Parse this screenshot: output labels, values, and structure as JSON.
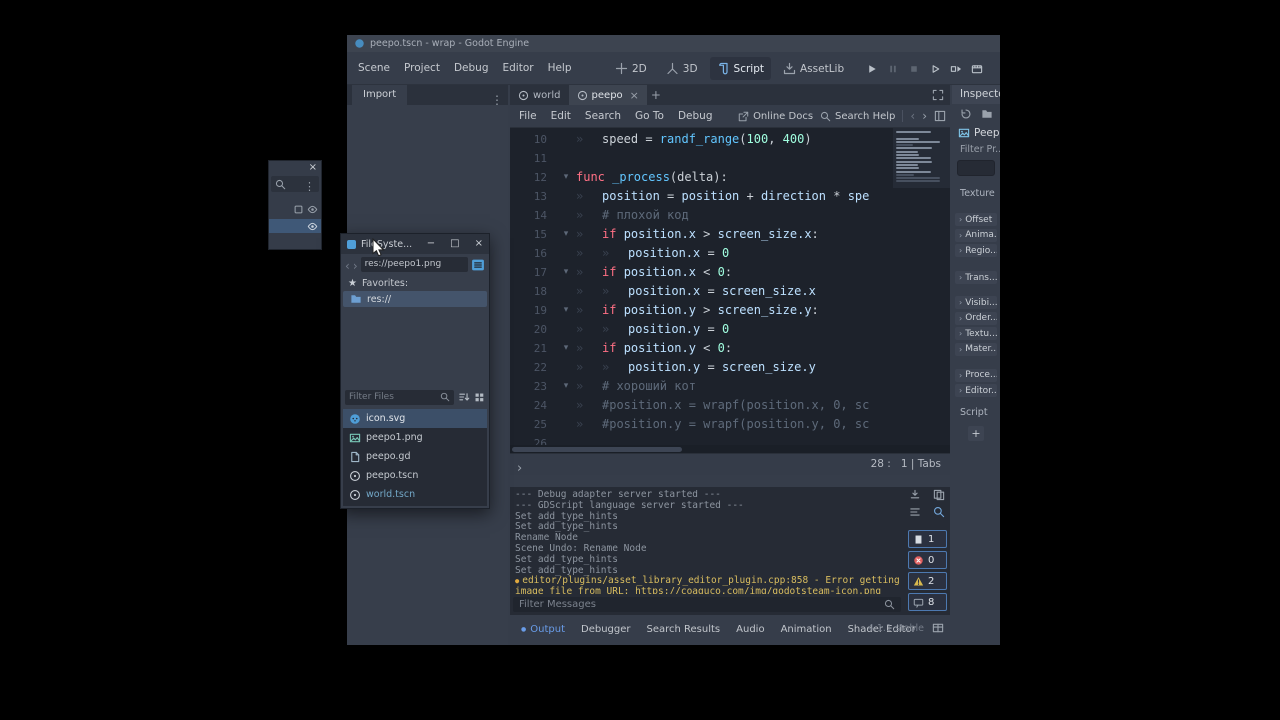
{
  "window": {
    "title": "peepo.tscn - wrap - Godot Engine"
  },
  "menubar": {
    "items": [
      "Scene",
      "Project",
      "Debug",
      "Editor",
      "Help"
    ]
  },
  "context_switcher": [
    {
      "label": "2D",
      "icon": "2d-icon",
      "active": false
    },
    {
      "label": "3D",
      "icon": "3d-icon",
      "active": false
    },
    {
      "label": "Script",
      "icon": "script-icon",
      "active": true
    },
    {
      "label": "AssetLib",
      "icon": "assetlib-icon",
      "active": false
    }
  ],
  "playbar": [
    {
      "icon": "play-icon",
      "enabled": true
    },
    {
      "icon": "pause-icon",
      "enabled": false
    },
    {
      "icon": "stop-icon",
      "enabled": false
    },
    {
      "icon": "play-scene-icon",
      "enabled": true
    },
    {
      "icon": "play-custom-scene-icon",
      "enabled": true
    },
    {
      "icon": "movie-maker-icon",
      "enabled": true
    }
  ],
  "left_dock": {
    "tab": "Import"
  },
  "scene_tabs": {
    "new_tab_label": "+",
    "tabs": [
      {
        "label": "world",
        "active": false,
        "closable": false
      },
      {
        "label": "peepo",
        "active": true,
        "closable": true
      }
    ]
  },
  "script_editor": {
    "menus": [
      "File",
      "Edit",
      "Search",
      "Go To",
      "Debug"
    ],
    "online_docs": "Online Docs",
    "search_help": "Search Help",
    "status": "28 :   1 | Tabs",
    "code": [
      {
        "n": "10",
        "fold": false,
        "ind": 1,
        "seg": [
          [
            "speed = ",
            "txt"
          ],
          [
            "randf_range",
            "fn"
          ],
          [
            "(",
            "txt"
          ],
          [
            "100",
            "num"
          ],
          [
            ", ",
            "txt"
          ],
          [
            "400",
            "num"
          ],
          [
            ")",
            "txt"
          ]
        ]
      },
      {
        "n": "11",
        "fold": false,
        "ind": 0,
        "seg": []
      },
      {
        "n": "12",
        "fold": true,
        "ind": 0,
        "seg": [
          [
            "func ",
            "kw"
          ],
          [
            "_process",
            "fn"
          ],
          [
            "(delta):",
            "txt"
          ]
        ]
      },
      {
        "n": "13",
        "fold": false,
        "ind": 1,
        "seg": [
          [
            "position",
            "mem"
          ],
          [
            " = ",
            "txt"
          ],
          [
            "position",
            "mem"
          ],
          [
            " + ",
            "txt"
          ],
          [
            "direction",
            "mem"
          ],
          [
            " * ",
            "txt"
          ],
          [
            "spe",
            "mem"
          ]
        ]
      },
      {
        "n": "14",
        "fold": false,
        "ind": 1,
        "seg": [
          [
            "# плохой код",
            "com"
          ]
        ]
      },
      {
        "n": "15",
        "fold": true,
        "ind": 1,
        "seg": [
          [
            "if ",
            "kw"
          ],
          [
            "position.x",
            "mem"
          ],
          [
            " > ",
            "txt"
          ],
          [
            "screen_size.x",
            "mem"
          ],
          [
            ":",
            "txt"
          ]
        ]
      },
      {
        "n": "16",
        "fold": false,
        "ind": 2,
        "seg": [
          [
            "position.x",
            "mem"
          ],
          [
            " = ",
            "txt"
          ],
          [
            "0",
            "num"
          ]
        ]
      },
      {
        "n": "17",
        "fold": true,
        "ind": 1,
        "seg": [
          [
            "if ",
            "kw"
          ],
          [
            "position.x",
            "mem"
          ],
          [
            " < ",
            "txt"
          ],
          [
            "0",
            "num"
          ],
          [
            ":",
            "txt"
          ]
        ]
      },
      {
        "n": "18",
        "fold": false,
        "ind": 2,
        "seg": [
          [
            "position.x",
            "mem"
          ],
          [
            " = ",
            "txt"
          ],
          [
            "screen_size.x",
            "mem"
          ]
        ]
      },
      {
        "n": "19",
        "fold": true,
        "ind": 1,
        "seg": [
          [
            "if ",
            "kw"
          ],
          [
            "position.y",
            "mem"
          ],
          [
            " > ",
            "txt"
          ],
          [
            "screen_size.y",
            "mem"
          ],
          [
            ":",
            "txt"
          ]
        ]
      },
      {
        "n": "20",
        "fold": false,
        "ind": 2,
        "seg": [
          [
            "position.y",
            "mem"
          ],
          [
            " = ",
            "txt"
          ],
          [
            "0",
            "num"
          ]
        ]
      },
      {
        "n": "21",
        "fold": true,
        "ind": 1,
        "seg": [
          [
            "if ",
            "kw"
          ],
          [
            "position.y",
            "mem"
          ],
          [
            " < ",
            "txt"
          ],
          [
            "0",
            "num"
          ],
          [
            ":",
            "txt"
          ]
        ]
      },
      {
        "n": "22",
        "fold": false,
        "ind": 2,
        "seg": [
          [
            "position.y",
            "mem"
          ],
          [
            " = ",
            "txt"
          ],
          [
            "screen_size.y",
            "mem"
          ]
        ]
      },
      {
        "n": "23",
        "fold": true,
        "ind": 1,
        "seg": [
          [
            "# хороший кот",
            "com"
          ]
        ]
      },
      {
        "n": "24",
        "fold": false,
        "ind": 1,
        "seg": [
          [
            "#position.x = wrapf(position.x, 0, sc",
            "com"
          ]
        ]
      },
      {
        "n": "25",
        "fold": false,
        "ind": 1,
        "seg": [
          [
            "#position.y = wrapf(position.y, 0, sc",
            "com"
          ]
        ]
      },
      {
        "n": "26",
        "fold": false,
        "ind": 0,
        "seg": []
      }
    ]
  },
  "output": {
    "lines": [
      {
        "t": "--- Debug adapter server started ---",
        "c": "std"
      },
      {
        "t": "--- GDScript language server started ---",
        "c": "std"
      },
      {
        "t": "Set add_type_hints",
        "c": "std"
      },
      {
        "t": "Set add_type_hints",
        "c": "std"
      },
      {
        "t": "Rename Node",
        "c": "std"
      },
      {
        "t": "Scene Undo: Rename Node",
        "c": "std"
      },
      {
        "t": "Set add_type_hints",
        "c": "std"
      },
      {
        "t": "Set add_type_hints",
        "c": "std"
      },
      {
        "t": "editor/plugins/asset_library_editor_plugin.cpp:858 - Error getting",
        "c": "warn",
        "bullet": true
      },
      {
        "t": "image file from URL: https://coaguco.com/img/godotsteam-icon.png",
        "c": "warn"
      }
    ],
    "tools": [
      {
        "icon": "clear-log-icon",
        "color": "#9aa2ac",
        "name": "clear-log-button"
      },
      {
        "icon": "copy-log-icon",
        "color": "#9aa2ac",
        "name": "copy-log-button"
      },
      {
        "icon": "collapse-log-icon",
        "color": "#9aa2ac",
        "name": "collapse-duplicates-button"
      },
      {
        "icon": "search-icon",
        "color": "#74a8dc",
        "name": "search-log-button"
      }
    ],
    "badges": [
      {
        "name": "log-filter-debug",
        "icon": "log-page-icon",
        "color": "#d8dde3",
        "count": "1"
      },
      {
        "name": "log-filter-errors",
        "icon": "log-error-icon",
        "color": "#e05f5f",
        "count": "0"
      },
      {
        "name": "log-filter-warnings",
        "icon": "log-warning-icon",
        "color": "#d8b94e",
        "count": "2"
      },
      {
        "name": "log-filter-messages",
        "icon": "log-message-icon",
        "color": "#9aa2ad",
        "count": "8"
      }
    ],
    "filter_placeholder": "Filter Messages"
  },
  "bottom_bar": {
    "tabs": [
      {
        "label": "Output",
        "active": true
      },
      {
        "label": "Debugger",
        "active": false
      },
      {
        "label": "Search Results",
        "active": false
      },
      {
        "label": "Audio",
        "active": false
      },
      {
        "label": "Animation",
        "active": false
      },
      {
        "label": "Shader Editor",
        "active": false
      }
    ],
    "version": "4.1.1.stable"
  },
  "inspector": {
    "tab": "Inspector",
    "toolbar_icons": [
      {
        "icon": "history-icon",
        "color": "#9aa2ac"
      },
      {
        "icon": "folder-icon",
        "color": "#9aa2ac"
      }
    ],
    "node_name": "Peep...",
    "filter_label": "Filter Pr...",
    "property_label": "Texture",
    "sections": [
      {
        "label": "Offset",
        "gap": 0
      },
      {
        "label": "Anima...",
        "gap": 2.5
      },
      {
        "label": "Regio...",
        "gap": 2.5
      },
      {
        "label": "Trans...",
        "gap": 14
      },
      {
        "label": "Visibi...",
        "gap": 12
      },
      {
        "label": "Order...",
        "gap": 2.5
      },
      {
        "label": "Textu...",
        "gap": 2.5
      },
      {
        "label": "Mater...",
        "gap": 2.5
      },
      {
        "label": "Proce...",
        "gap": 13
      },
      {
        "label": "Editor...",
        "gap": 2.5
      }
    ],
    "script_label": "Script",
    "add_label": "+"
  },
  "scene_dock_fragment": {
    "close_glyph": "×",
    "rows": [
      {
        "icons": [
          "node-icon",
          "eye-icon"
        ],
        "selected": false
      },
      {
        "icons": [
          "eye-icon"
        ],
        "selected": true
      }
    ]
  },
  "fs_window": {
    "title": "FileSyste...",
    "controls": {
      "minimize": "−",
      "maximize": "□",
      "close": "×"
    },
    "path": "res://peepo1.png",
    "favorites_label": "Favorites:",
    "favorites": [
      {
        "label": "res://",
        "icon": "folder-icon",
        "color": "#6d9fd2",
        "selected": true
      }
    ],
    "filter_placeholder": "Filter Files",
    "files": [
      {
        "label": "icon.svg",
        "icon": "godot-file-icon",
        "color": "#4f9ed8",
        "selected": true
      },
      {
        "label": "peepo1.png",
        "icon": "image-file-icon",
        "color": "#79c8b7",
        "selected": false
      },
      {
        "label": "peepo.gd",
        "icon": "gdscript-file-icon",
        "color": "#9fb7c8",
        "selected": false
      },
      {
        "label": "peepo.tscn",
        "icon": "scene-file-icon",
        "color": "#c7cdd4",
        "selected": false
      },
      {
        "label": "world.tscn",
        "icon": "scene-file-icon",
        "color": "#c7cdd4",
        "selected": false,
        "text_color": "#73a8c8"
      }
    ]
  },
  "static_icons": [
    [
      "#tb-logo",
      "godot-logo-icon",
      "#478cbf",
      11
    ],
    [
      "#dock-kebab",
      "kebab-icon",
      "#9aa2ac",
      12
    ],
    [
      "#dfree",
      "distraction-free-icon",
      "#9aa2ac",
      12
    ],
    [
      "#od-ic",
      "external-link-icon",
      "#9aa2ac",
      11
    ],
    [
      "#sh-ic",
      "search-icon",
      "#9aa2ac",
      11
    ],
    [
      "#nav-back",
      "back-icon",
      "#6b7380",
      12
    ],
    [
      "#nav-fwd",
      "forward-icon",
      "#9aa2ac",
      12
    ],
    [
      "#sp-ic",
      "scripts-panel-icon",
      "#9aa2ac",
      12
    ],
    [
      "#es-chev",
      "chevron-icon",
      "#9aa2ac",
      13
    ],
    [
      "#fm-ic",
      "search-icon",
      "#8b929d",
      11
    ],
    [
      "#bp-grid",
      "bottom-panel-grid-icon",
      "#9aa2ac",
      12
    ],
    [
      "#fs-back",
      "back-icon",
      "#717987",
      12
    ],
    [
      "#fs-fwd",
      "forward-icon",
      "#717987",
      12
    ],
    [
      "#fs-split",
      "split-mode-icon",
      "#4f9ed8",
      14
    ],
    [
      "#fs-star",
      "star-icon",
      "#c9ced5",
      10
    ],
    [
      "#ff-ic",
      "search-icon",
      "#8b929d",
      10
    ],
    [
      "#fs-sort",
      "sort-files-icon",
      "#b4bbc4",
      12
    ],
    [
      "#fs-grid",
      "grid-view-icon",
      "#b4bbc4",
      11
    ],
    [
      "#sd-search",
      "search-icon",
      "#9aa2ac",
      11
    ],
    [
      "#sd-kebab",
      "kebab-icon",
      "#9aa2ac",
      11
    ],
    [
      "#insp-node-icon",
      "sprite-icon",
      "#7fc4e8",
      12
    ]
  ],
  "colors": {
    "accent": "#699ce8",
    "keyword": "#ff7085",
    "function": "#62c6ff",
    "member": "#bce0ff",
    "number": "#a1ffe0",
    "comment": "#5e6a7a",
    "warning": "#d9bd5f",
    "error": "#e05f5f",
    "selection": "#3c5069"
  }
}
